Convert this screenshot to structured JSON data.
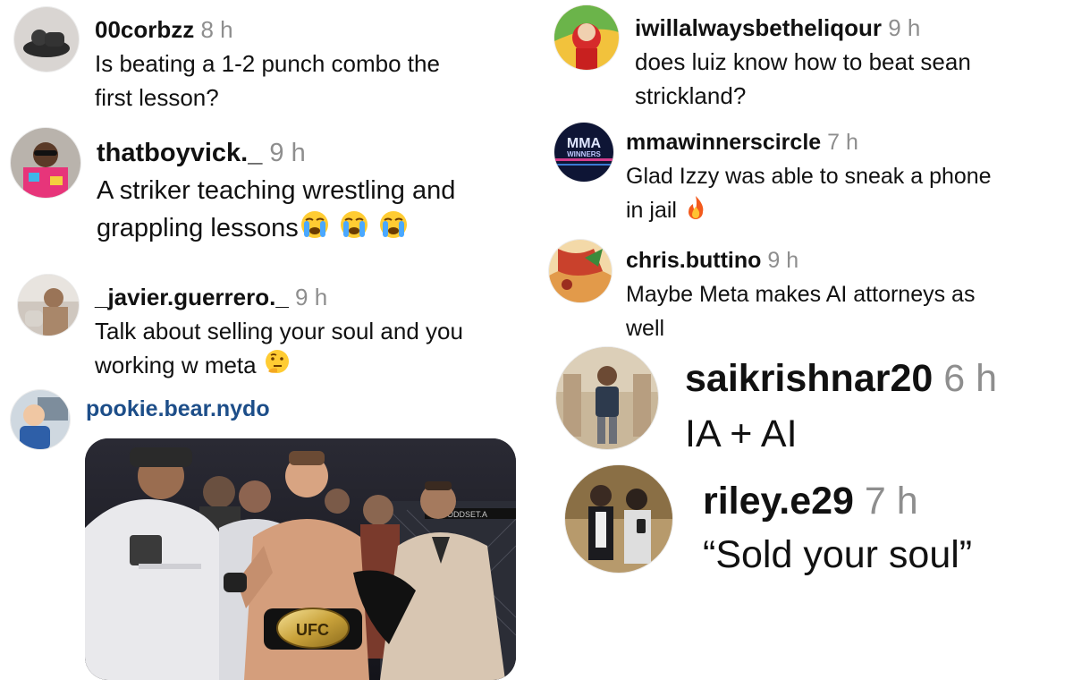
{
  "comments_left": [
    {
      "username": "00corbzz",
      "time": "8 h",
      "lines": [
        "Is beating a 1-2 punch combo the",
        "first lesson?"
      ]
    },
    {
      "username": "thatboyvick._",
      "time": "9 h",
      "lines": [
        "A striker teaching wrestling and",
        "grappling lessons"
      ],
      "emoji": [
        "loudly-crying-face",
        "loudly-crying-face",
        "loudly-crying-face"
      ]
    },
    {
      "username": "_javier.guerrero._",
      "time": "9 h",
      "lines": [
        "Talk about selling your soul and you",
        "working w meta"
      ],
      "emoji": [
        "thinking-face"
      ]
    },
    {
      "username": "pookie.bear.nydo",
      "time": ""
    }
  ],
  "comments_right": [
    {
      "username": "iwillalwaysbetheliqour",
      "time": "9 h",
      "lines": [
        "does luiz know how to beat sean",
        "strickland?"
      ]
    },
    {
      "username": "mmawinnerscircle",
      "time": "7 h",
      "lines": [
        "Glad Izzy was able to sneak a phone",
        "in jail"
      ],
      "emoji": [
        "fire"
      ]
    },
    {
      "username": "chris.buttino",
      "time": "9 h",
      "lines": [
        "Maybe Meta makes AI attorneys as",
        "well"
      ]
    },
    {
      "username": "saikrishnar20",
      "time": "6 h",
      "lines": [
        "IA + AI"
      ]
    },
    {
      "username": "riley.e29",
      "time": "7 h",
      "lines": [
        "“Sold your soul”"
      ]
    }
  ],
  "gif": {
    "belt_text": "UFC",
    "banner_text": "ODDSET.A"
  },
  "avatar_texts": {
    "mma_logo_line1": "MMA",
    "mma_logo_line2": "WINNERS"
  },
  "colors": {
    "username": "#111111",
    "time": "#8e8e8e",
    "link_username": "#1d4e89",
    "text": "#111111"
  }
}
